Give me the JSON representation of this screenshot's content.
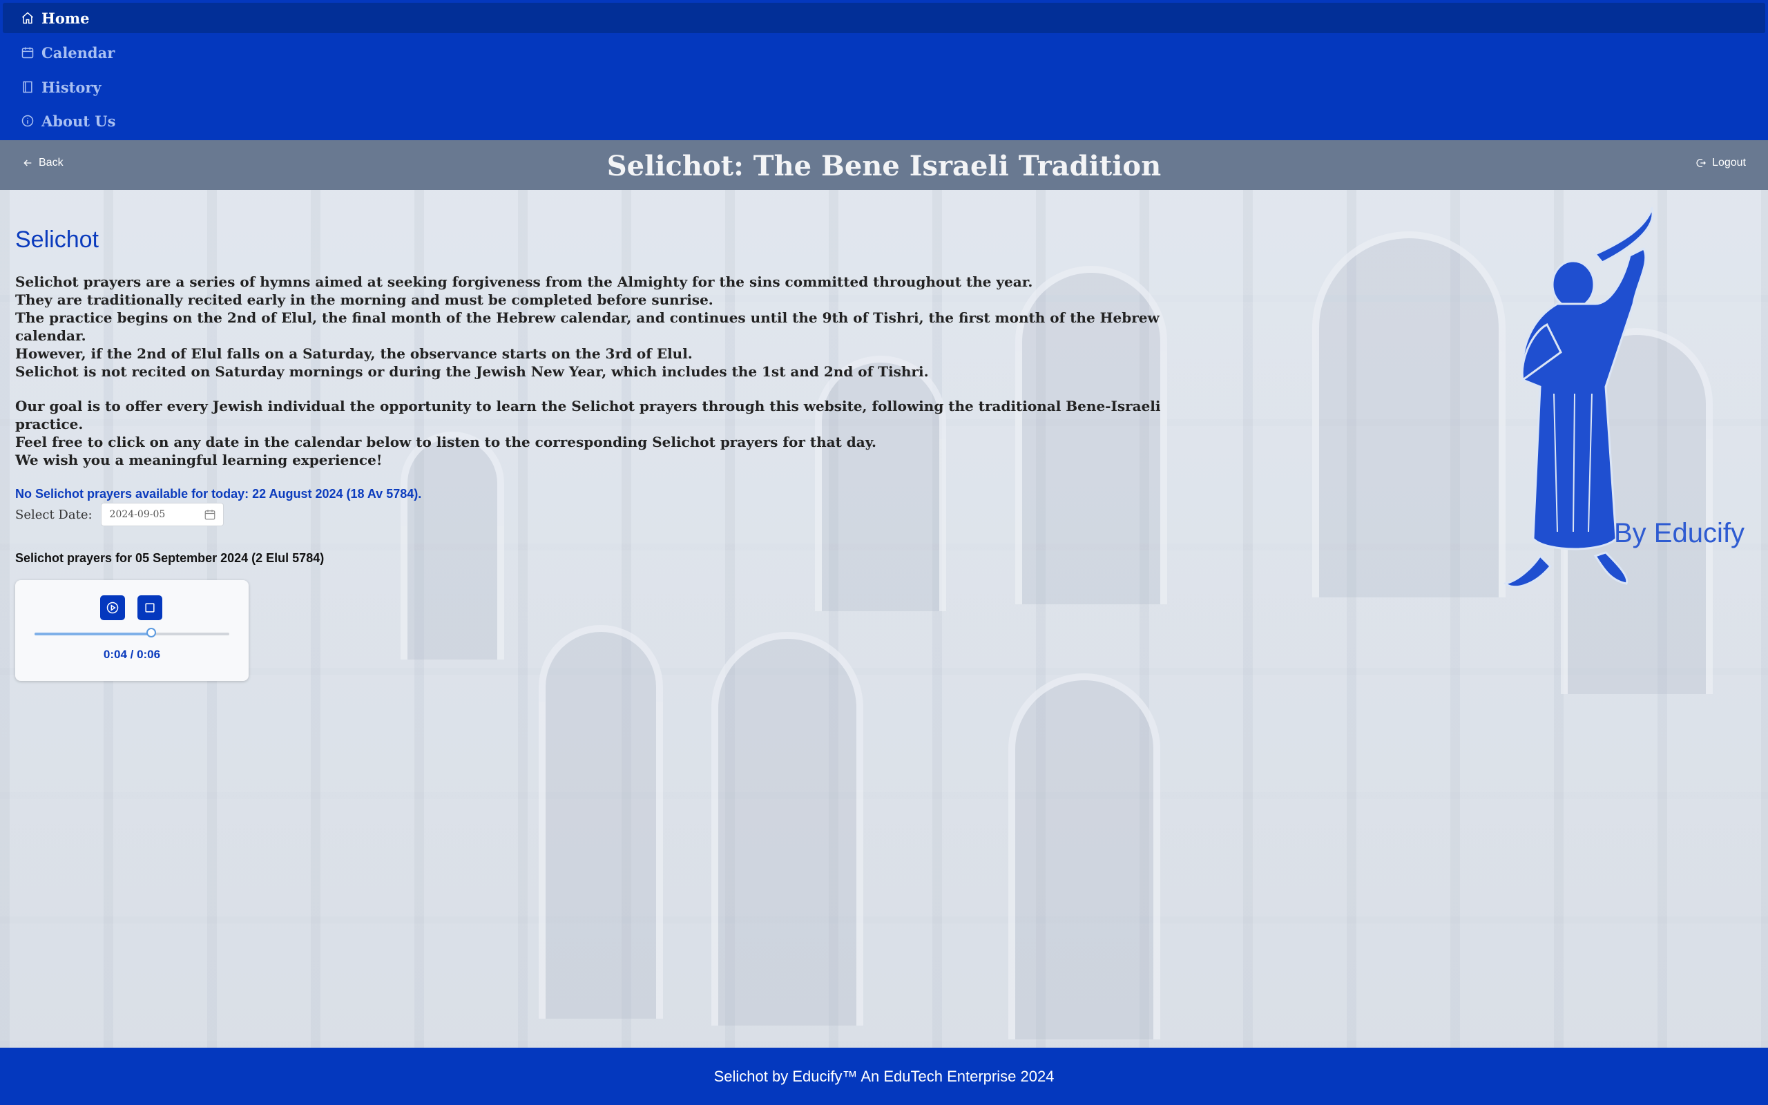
{
  "nav": {
    "items": [
      {
        "label": "Home",
        "icon": "home-icon",
        "active": true
      },
      {
        "label": "Calendar",
        "icon": "calendar-icon",
        "active": false
      },
      {
        "label": "History",
        "icon": "book-icon",
        "active": false
      },
      {
        "label": "About Us",
        "icon": "info-icon",
        "active": false
      }
    ]
  },
  "header": {
    "back_label": "Back",
    "title": "Selichot: The Bene Israeli Tradition",
    "logout_label": "Logout"
  },
  "main": {
    "section_title": "Selichot",
    "paragraph1": [
      "Selichot prayers are a series of hymns aimed at seeking forgiveness from the Almighty for the sins committed throughout the year.",
      "They are traditionally recited early in the morning and must be completed before sunrise.",
      "The practice begins on the 2nd of Elul, the final month of the Hebrew calendar, and continues until the 9th of Tishri, the first month of the Hebrew calendar.",
      "However, if the 2nd of Elul falls on a Saturday, the observance starts on the 3rd of Elul.",
      "Selichot is not recited on Saturday mornings or during the Jewish New Year, which includes the 1st and 2nd of Tishri."
    ],
    "paragraph2": [
      "Our goal is to offer every Jewish individual the opportunity to learn the Selichot prayers through this website, following the traditional Bene-Israeli practice.",
      "Feel free to click on any date in the calendar below to listen to the corresponding Selichot prayers for that day.",
      "We wish you a meaningful learning experience!"
    ],
    "today_note": "No Selichot prayers available for today: 22 August 2024 (18 Av 5784).",
    "date_label": "Select Date:",
    "date_value": "2024-09-05",
    "prayers_heading": "Selichot prayers for 05 September 2024 (2 Elul 5784)"
  },
  "player": {
    "time_display": "0:04 / 0:06",
    "progress": 0.6,
    "play_icon": "play-icon",
    "stop_icon": "stop-icon"
  },
  "brand": {
    "text": "By Educify"
  },
  "footer": {
    "text": "Selichot by Educify™ An EduTech Enterprise 2024"
  },
  "colors": {
    "primary": "#0438be",
    "nav_active": "#022f97",
    "accent_text": "#0b3bbd"
  }
}
